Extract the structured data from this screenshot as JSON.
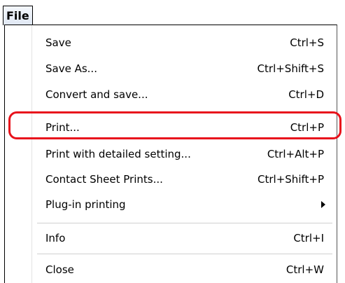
{
  "menubar": {
    "file_label": "File"
  },
  "menu": {
    "items": [
      {
        "label": "Save",
        "shortcut": "Ctrl+S"
      },
      {
        "label": "Save As...",
        "shortcut": "Ctrl+Shift+S"
      },
      {
        "label": "Convert and save...",
        "shortcut": "Ctrl+D"
      },
      {
        "label": "Print...",
        "shortcut": "Ctrl+P"
      },
      {
        "label": "Print with detailed setting...",
        "shortcut": "Ctrl+Alt+P"
      },
      {
        "label": "Contact Sheet Prints...",
        "shortcut": "Ctrl+Shift+P"
      },
      {
        "label": "Plug-in printing",
        "shortcut": ""
      },
      {
        "label": "Info",
        "shortcut": "Ctrl+I"
      },
      {
        "label": "Close",
        "shortcut": "Ctrl+W"
      }
    ]
  },
  "annotation": {
    "highlight_color": "#e8121c",
    "highlighted_item": "Print..."
  }
}
